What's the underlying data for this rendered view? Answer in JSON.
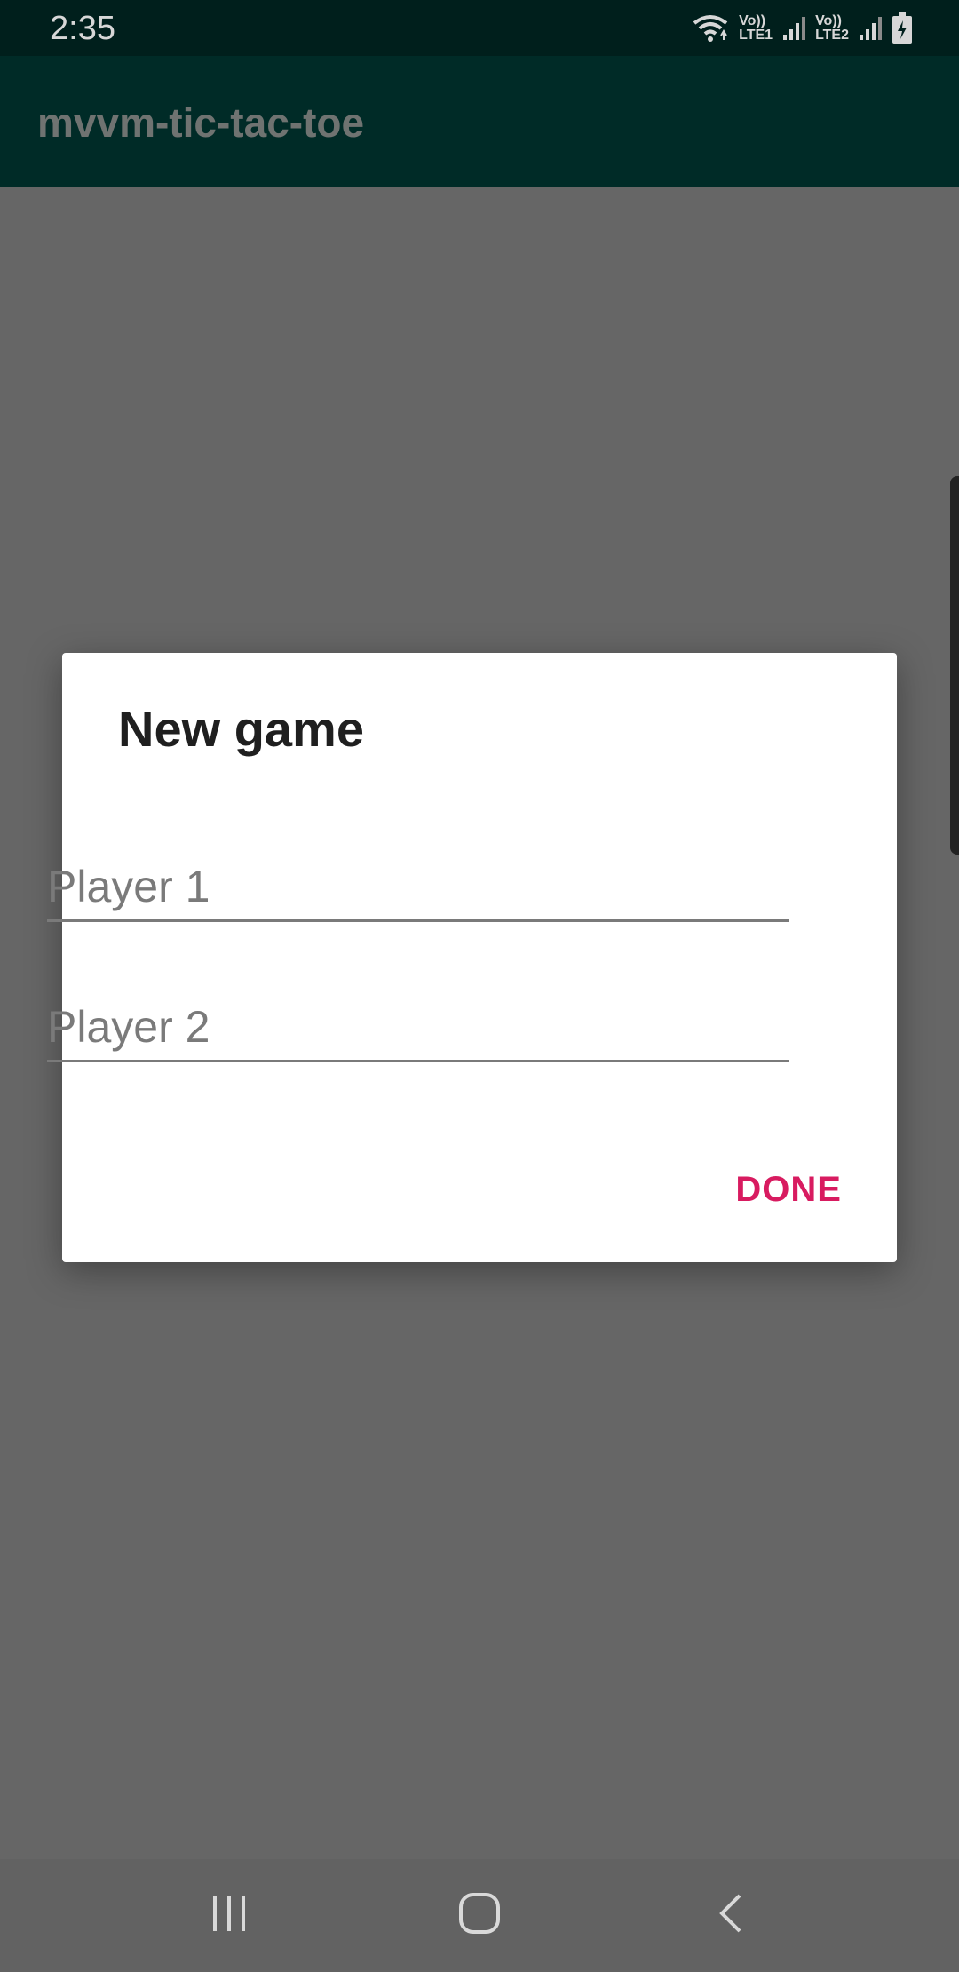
{
  "status_bar": {
    "time": "2:35",
    "sim1_label_top": "Vo))",
    "sim1_label_bottom": "LTE1",
    "sim2_label_top": "Vo))",
    "sim2_label_bottom": "LTE2",
    "icons": [
      "wifi-icon",
      "signal-icon",
      "signal-icon",
      "battery-charging-icon"
    ]
  },
  "app_bar": {
    "title": "mvvm-tic-tac-toe"
  },
  "dialog": {
    "title": "New game",
    "player1": {
      "placeholder": "Player 1",
      "value": ""
    },
    "player2": {
      "placeholder": "Player 2",
      "value": ""
    },
    "done_label": "DONE"
  },
  "nav_bar": {
    "icons": [
      "recents-icon",
      "home-icon",
      "back-icon"
    ]
  },
  "colors": {
    "accent": "#d81b60",
    "app_bar": "#002b27",
    "status_bar": "#001f1c",
    "scrim": "#666666"
  }
}
